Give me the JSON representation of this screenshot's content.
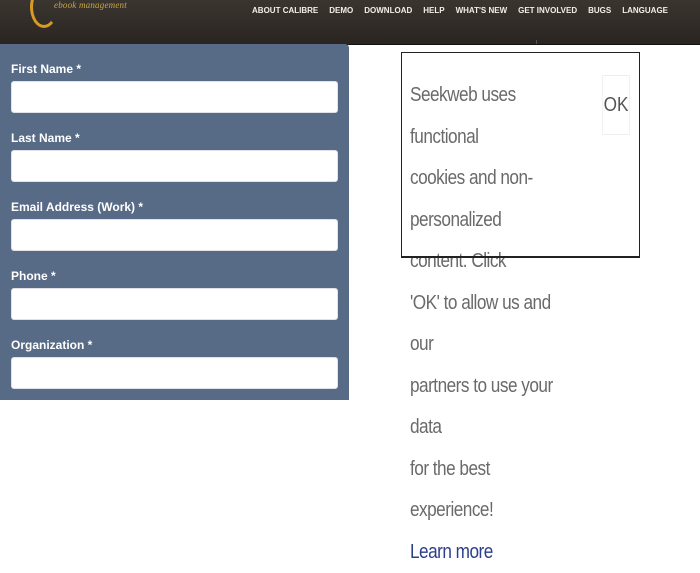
{
  "header": {
    "logo_text": "ebook management",
    "nav": [
      "About Calibre",
      "Demo",
      "Download",
      "Help",
      "What's New",
      "Get Involved",
      "Bugs",
      "Language"
    ]
  },
  "form": {
    "fields": [
      {
        "label": "First Name *",
        "value": ""
      },
      {
        "label": "Last Name *",
        "value": ""
      },
      {
        "label": "Email Address (Work) *",
        "value": ""
      },
      {
        "label": "Phone *",
        "value": ""
      },
      {
        "label": "Organization *",
        "value": ""
      }
    ]
  },
  "cookie_notice": {
    "lines": [
      "Seekweb uses functional",
      "cookies and non-",
      "personalized content. Click",
      "'OK' to allow us and our",
      "partners to use your data",
      "for the best experience!"
    ],
    "learn_more": "Learn more",
    "ok_label": "OK"
  },
  "colors": {
    "header_bg": "#2f2a25",
    "form_bg": "#576a86",
    "logo_accent": "#d79a24",
    "link": "#2b3f8c"
  }
}
